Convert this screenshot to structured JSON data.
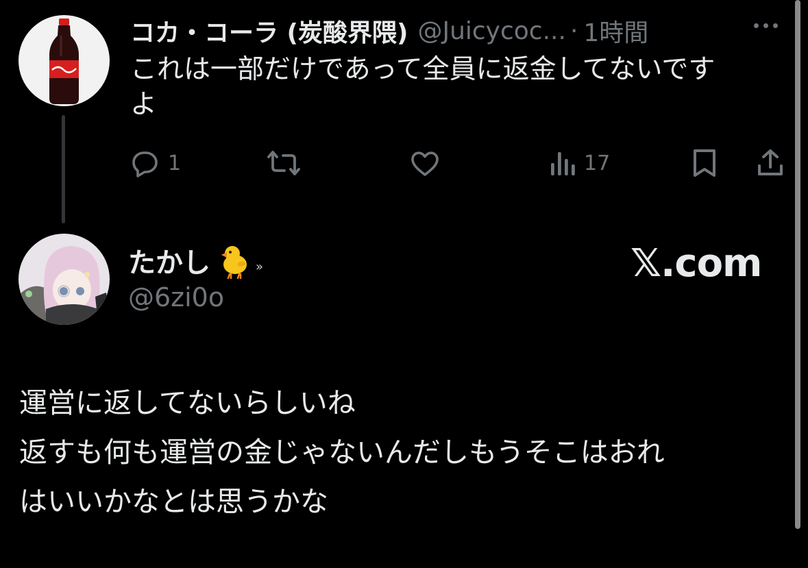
{
  "tweet1": {
    "display_name": "コカ・コーラ (炭酸界隈)",
    "handle": "@Juicycoc...",
    "separator": "·",
    "time": "1時間",
    "text_line1": "これは一部だけであって全員に返金してないです",
    "text_line2": "よ",
    "reply_count": "1",
    "views_count": "17"
  },
  "tweet2": {
    "display_name": "たかし",
    "name_suffix": "»",
    "handle": "@6zi0o",
    "watermark": "𝕏.com",
    "text_lines": [
      "運営に返してないらしいね",
      "返すも何も運営の金じゃないんだしもうそこはおれ",
      "はいいかなとは思うかな"
    ]
  },
  "icons": {
    "more": "more-horizontal-icon",
    "reply": "reply-icon",
    "retweet": "retweet-icon",
    "like": "heart-icon",
    "views": "views-icon",
    "bookmark": "bookmark-icon",
    "share": "share-icon",
    "chick": "chick-emoji-icon"
  },
  "colors": {
    "background": "#000000",
    "text_primary": "#e7e9ea",
    "text_secondary": "#71767b",
    "thread_line": "#333639"
  }
}
